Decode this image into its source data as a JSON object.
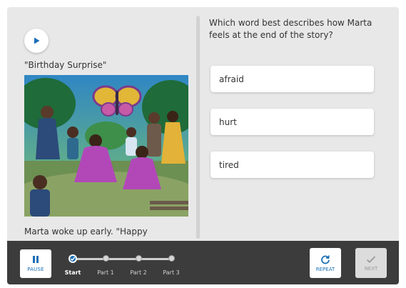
{
  "story": {
    "title": "\"Birthday Surprise\"",
    "text_excerpt": "Marta woke up early. \"Happy"
  },
  "question": {
    "prompt": "Which word best describes how Marta feels at the end of the story?",
    "answers": [
      "afraid",
      "hurt",
      "tired"
    ]
  },
  "controls": {
    "pause_label": "PAUSE",
    "repeat_label": "REPEAT",
    "next_label": "NEXT",
    "next_enabled": false
  },
  "progress": {
    "steps": [
      "Start",
      "Part 1",
      "Part 2",
      "Part 3"
    ],
    "current_index": 0
  },
  "colors": {
    "accent": "#1a6fb5",
    "bottom_bar": "#3c3c3c",
    "panel": "#e8e8e8"
  },
  "icons": {
    "play": "play-icon",
    "pause": "pause-icon",
    "repeat": "repeat-icon",
    "next": "checkmark-icon",
    "progress_current": "checkmark-icon"
  }
}
